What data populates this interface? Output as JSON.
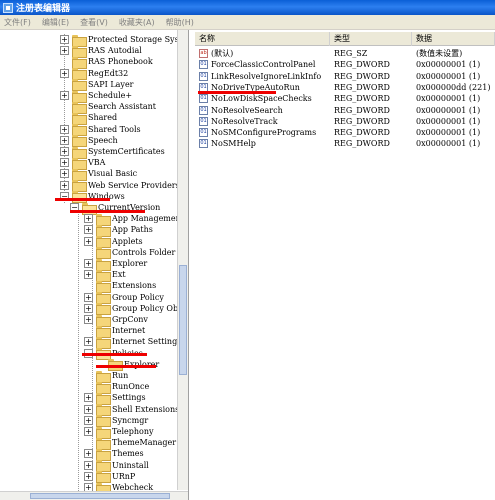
{
  "window": {
    "title": "注册表编辑器"
  },
  "menu": [
    "文件(F)",
    "编辑(E)",
    "查看(V)",
    "收藏夹(A)",
    "帮助(H)"
  ],
  "tree": {
    "items": [
      {
        "label": "Protected Storage Syst",
        "expander": "+"
      },
      {
        "label": "RAS Autodial",
        "expander": "+"
      },
      {
        "label": "RAS Phonebook",
        "expander": ""
      },
      {
        "label": "RegEdt32",
        "expander": "+"
      },
      {
        "label": "SAPI Layer",
        "expander": ""
      },
      {
        "label": "Schedule+",
        "expander": "+"
      },
      {
        "label": "Search Assistant",
        "expander": ""
      },
      {
        "label": "Shared",
        "expander": ""
      },
      {
        "label": "Shared Tools",
        "expander": "+"
      },
      {
        "label": "Speech",
        "expander": "+"
      },
      {
        "label": "SystemCertificates",
        "expander": "+"
      },
      {
        "label": "VBA",
        "expander": "+"
      },
      {
        "label": "Visual Basic",
        "expander": "+"
      },
      {
        "label": "Web Service Providers",
        "expander": "+"
      },
      {
        "label": "Windows",
        "expander": "−"
      },
      {
        "label": "CurrentVersion",
        "expander": "−"
      },
      {
        "label": "App Management",
        "expander": "+"
      },
      {
        "label": "App Paths",
        "expander": "+"
      },
      {
        "label": "Applets",
        "expander": "+"
      },
      {
        "label": "Controls Folder",
        "expander": ""
      },
      {
        "label": "Explorer",
        "expander": "+"
      },
      {
        "label": "Ext",
        "expander": "+"
      },
      {
        "label": "Extensions",
        "expander": ""
      },
      {
        "label": "Group Policy",
        "expander": "+"
      },
      {
        "label": "Group Policy Obj",
        "expander": "+"
      },
      {
        "label": "GrpConv",
        "expander": "+"
      },
      {
        "label": "Internet",
        "expander": ""
      },
      {
        "label": "Internet Setting",
        "expander": "+"
      },
      {
        "label": "Policies",
        "expander": "−"
      },
      {
        "label": "Explorer",
        "expander": ""
      },
      {
        "label": "Run",
        "expander": ""
      },
      {
        "label": "RunOnce",
        "expander": ""
      },
      {
        "label": "Settings",
        "expander": "+"
      },
      {
        "label": "Shell Extensions",
        "expander": "+"
      },
      {
        "label": "Syncmgr",
        "expander": "+"
      },
      {
        "label": "Telephony",
        "expander": "+"
      },
      {
        "label": "ThemeManager",
        "expander": ""
      },
      {
        "label": "Themes",
        "expander": "+"
      },
      {
        "label": "Uninstall",
        "expander": "+"
      },
      {
        "label": "URnP",
        "expander": "+"
      },
      {
        "label": "Webcheck",
        "expander": "+"
      }
    ]
  },
  "list": {
    "columns": [
      "名称",
      "类型",
      "数据"
    ],
    "rows": [
      {
        "icon": "ab",
        "name": "(默认)",
        "type": "REG_SZ",
        "data": "(数值未设置)"
      },
      {
        "icon": "01",
        "name": "ForceClassicControlPanel",
        "type": "REG_DWORD",
        "data": "0x00000001 (1)"
      },
      {
        "icon": "01",
        "name": "LinkResolveIgnoreLinkInfo",
        "type": "REG_DWORD",
        "data": "0x00000001 (1)"
      },
      {
        "icon": "01",
        "name": "NoDriveTypeAutoRun",
        "type": "REG_DWORD",
        "data": "0x000000dd (221)"
      },
      {
        "icon": "01",
        "name": "NoLowDiskSpaceChecks",
        "type": "REG_DWORD",
        "data": "0x00000001 (1)"
      },
      {
        "icon": "01",
        "name": "NoResolveSearch",
        "type": "REG_DWORD",
        "data": "0x00000001 (1)"
      },
      {
        "icon": "01",
        "name": "NoResolveTrack",
        "type": "REG_DWORD",
        "data": "0x00000001 (1)"
      },
      {
        "icon": "01",
        "name": "NoSMConfigurePrograms",
        "type": "REG_DWORD",
        "data": "0x00000001 (1)"
      },
      {
        "icon": "01",
        "name": "NoSMHelp",
        "type": "REG_DWORD",
        "data": "0x00000001 (1)"
      }
    ]
  },
  "colors": {
    "title_bar": "#0a5fd6",
    "menu_bg": "#ece9d8",
    "highlight_mark": "#ee0000",
    "folder": "#f5d67a"
  }
}
